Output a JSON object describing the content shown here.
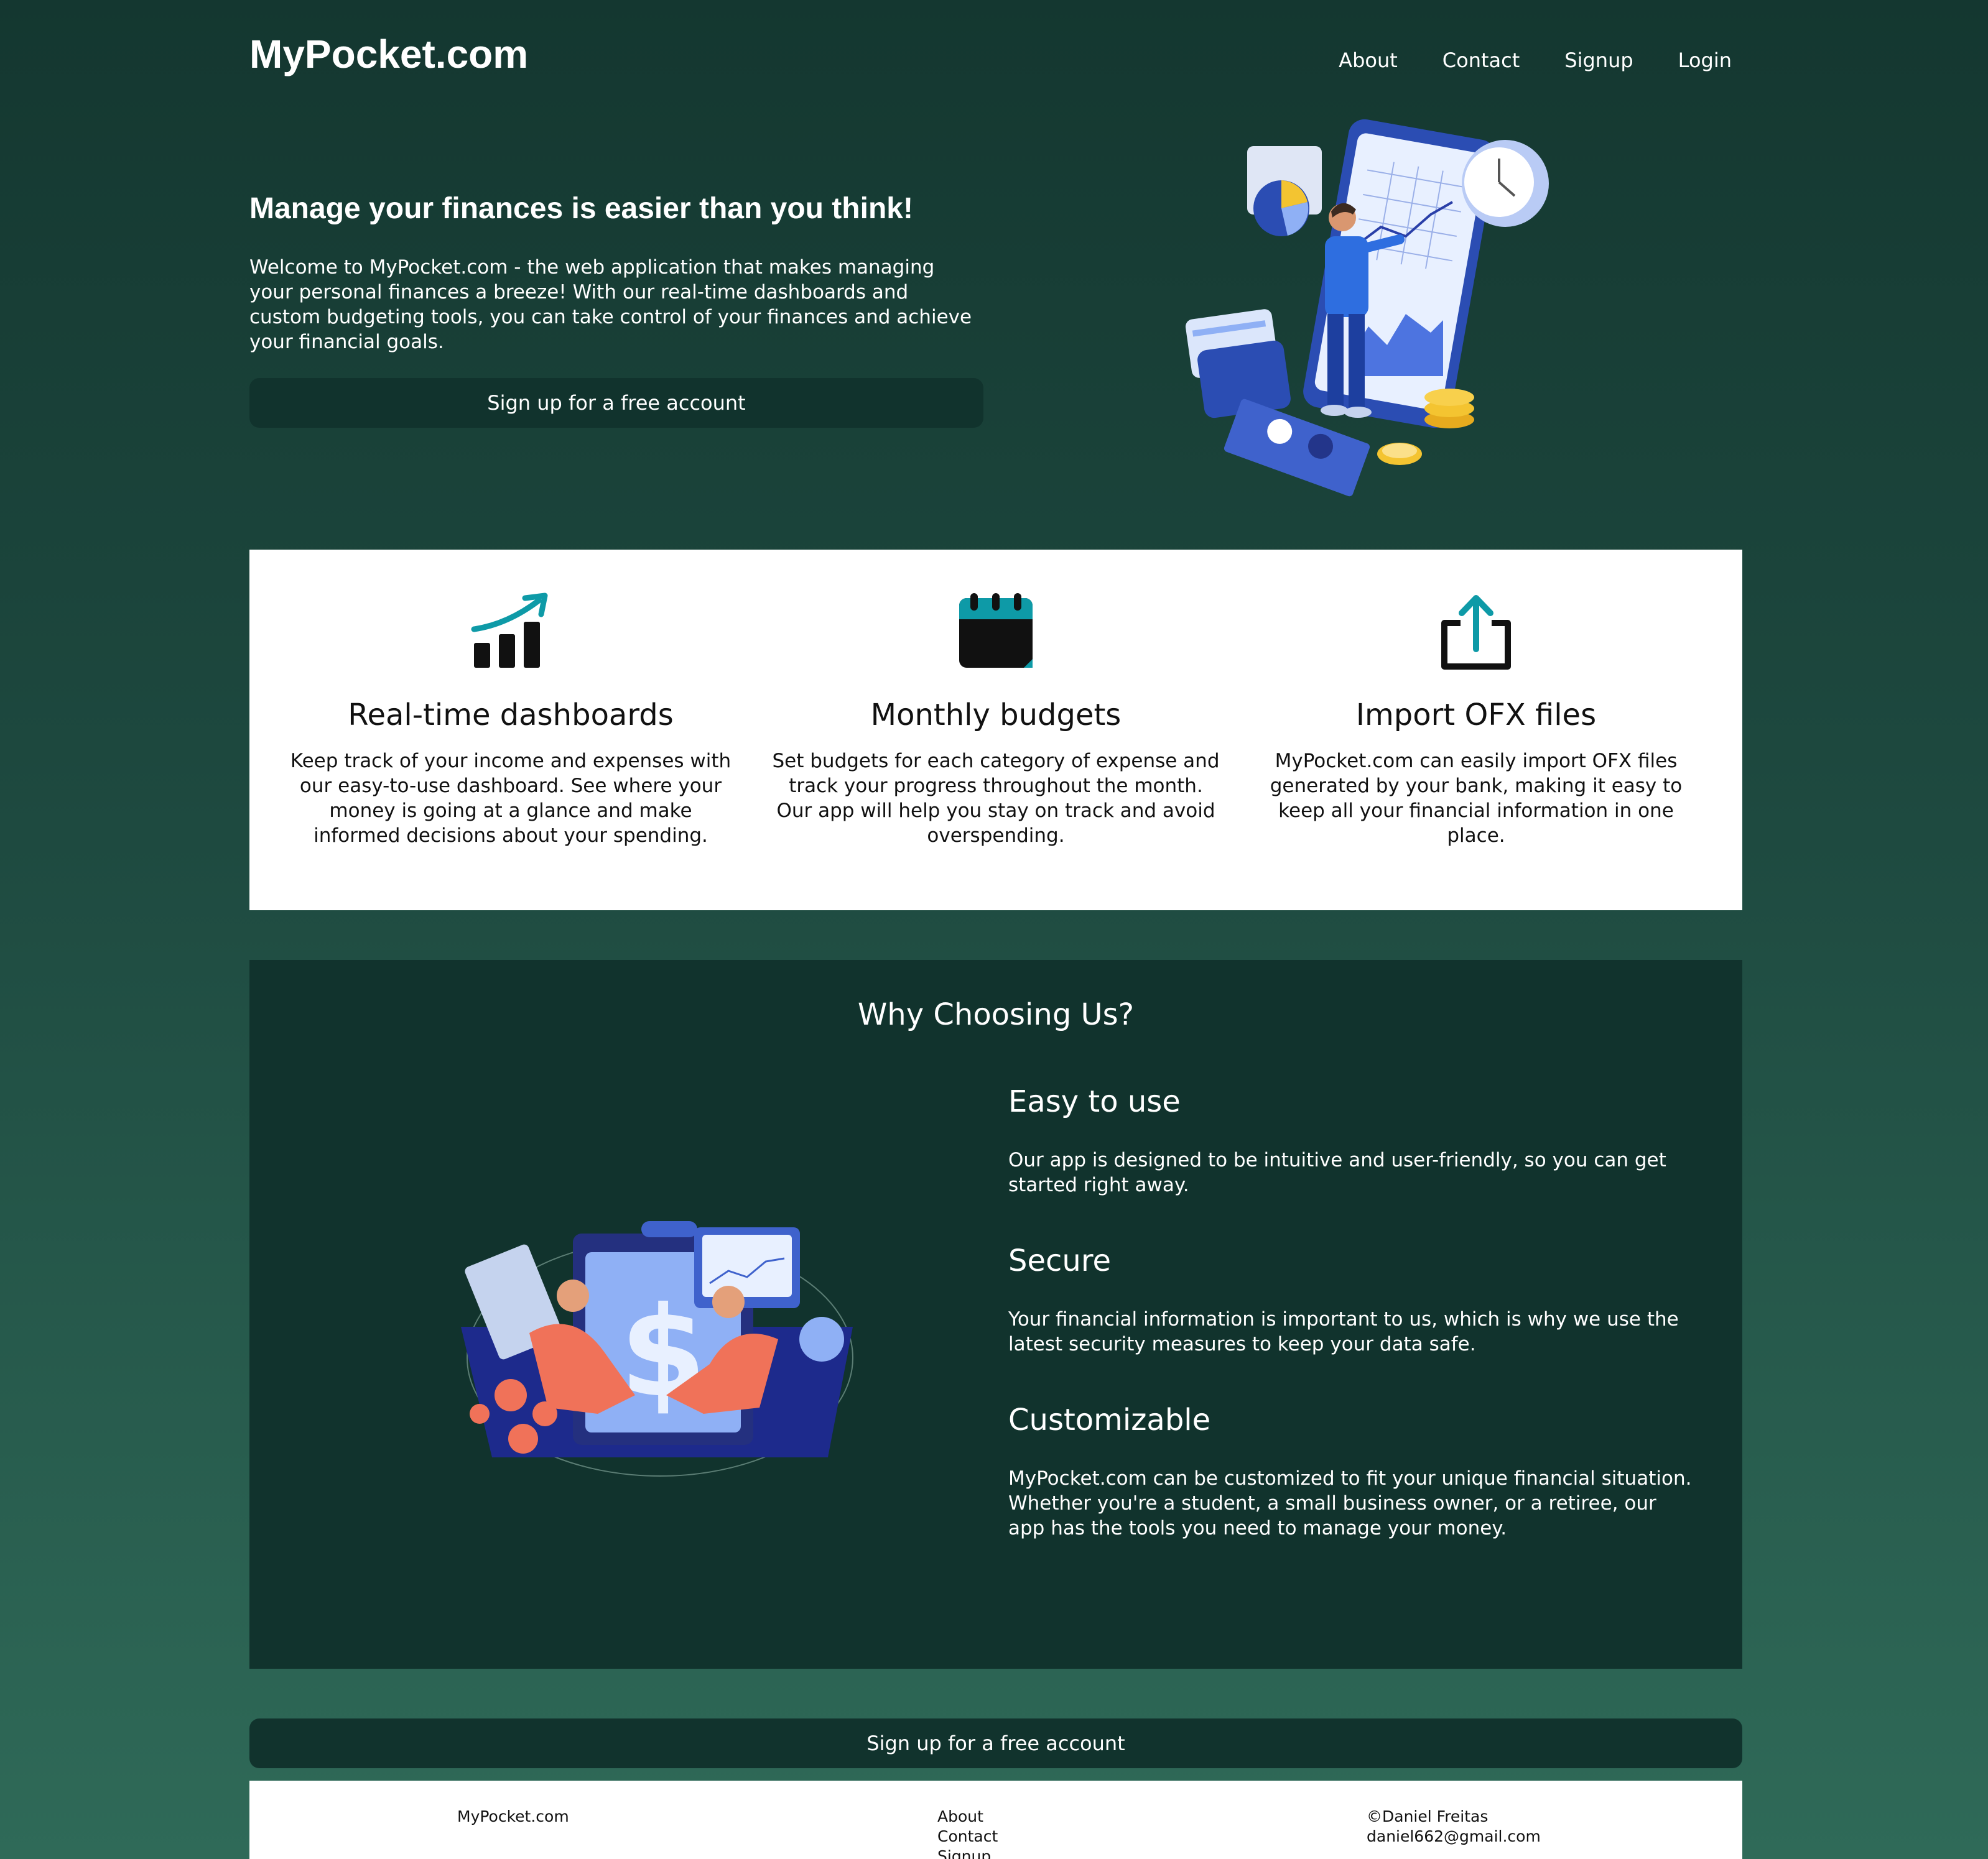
{
  "header": {
    "logo": "MyPocket.com",
    "nav": [
      "About",
      "Contact",
      "Signup",
      "Login"
    ]
  },
  "hero": {
    "title": "Manage your finances is easier than you think!",
    "text": "Welcome to MyPocket.com - the web application that makes managing your personal finances a breeze! With our real-time dashboards and custom budgeting tools, you can take control of your finances and achieve your financial goals.",
    "cta": "Sign up for a free account"
  },
  "features": [
    {
      "icon": "chart-growth-icon",
      "title": "Real-time dashboards",
      "text": "Keep track of your income and expenses with our easy-to-use dashboard. See where your money is going at a glance and make informed decisions about your spending."
    },
    {
      "icon": "calendar-icon",
      "title": "Monthly budgets",
      "text": "Set budgets for each category of expense and track your progress throughout the month. Our app will help you stay on track and avoid overspending."
    },
    {
      "icon": "upload-share-icon",
      "title": "Import OFX files",
      "text": "MyPocket.com can easily import OFX files generated by your bank, making it easy to keep all your financial information in one place."
    }
  ],
  "why": {
    "title": "Why Choosing Us?",
    "items": [
      {
        "title": "Easy to use",
        "text": "Our app is designed to be intuitive and user-friendly, so you can get started right away."
      },
      {
        "title": "Secure",
        "text": "Your financial information is important to us, which is why we use the latest security measures to keep your data safe."
      },
      {
        "title": "Customizable",
        "text": "MyPocket.com can be customized to fit your unique financial situation. Whether you're a student, a small business owner, or a retiree, our app has the tools you need to manage your money."
      }
    ]
  },
  "bottom_cta": "Sign up for a free account",
  "footer": {
    "brand": "MyPocket.com",
    "links": [
      "About",
      "Contact",
      "Signup"
    ],
    "copyright": "©Daniel Freitas",
    "email": "daniel662@gmail.com"
  },
  "colors": {
    "background": "#143730",
    "panel": "#11332d",
    "accent": "#0e9aa7"
  }
}
